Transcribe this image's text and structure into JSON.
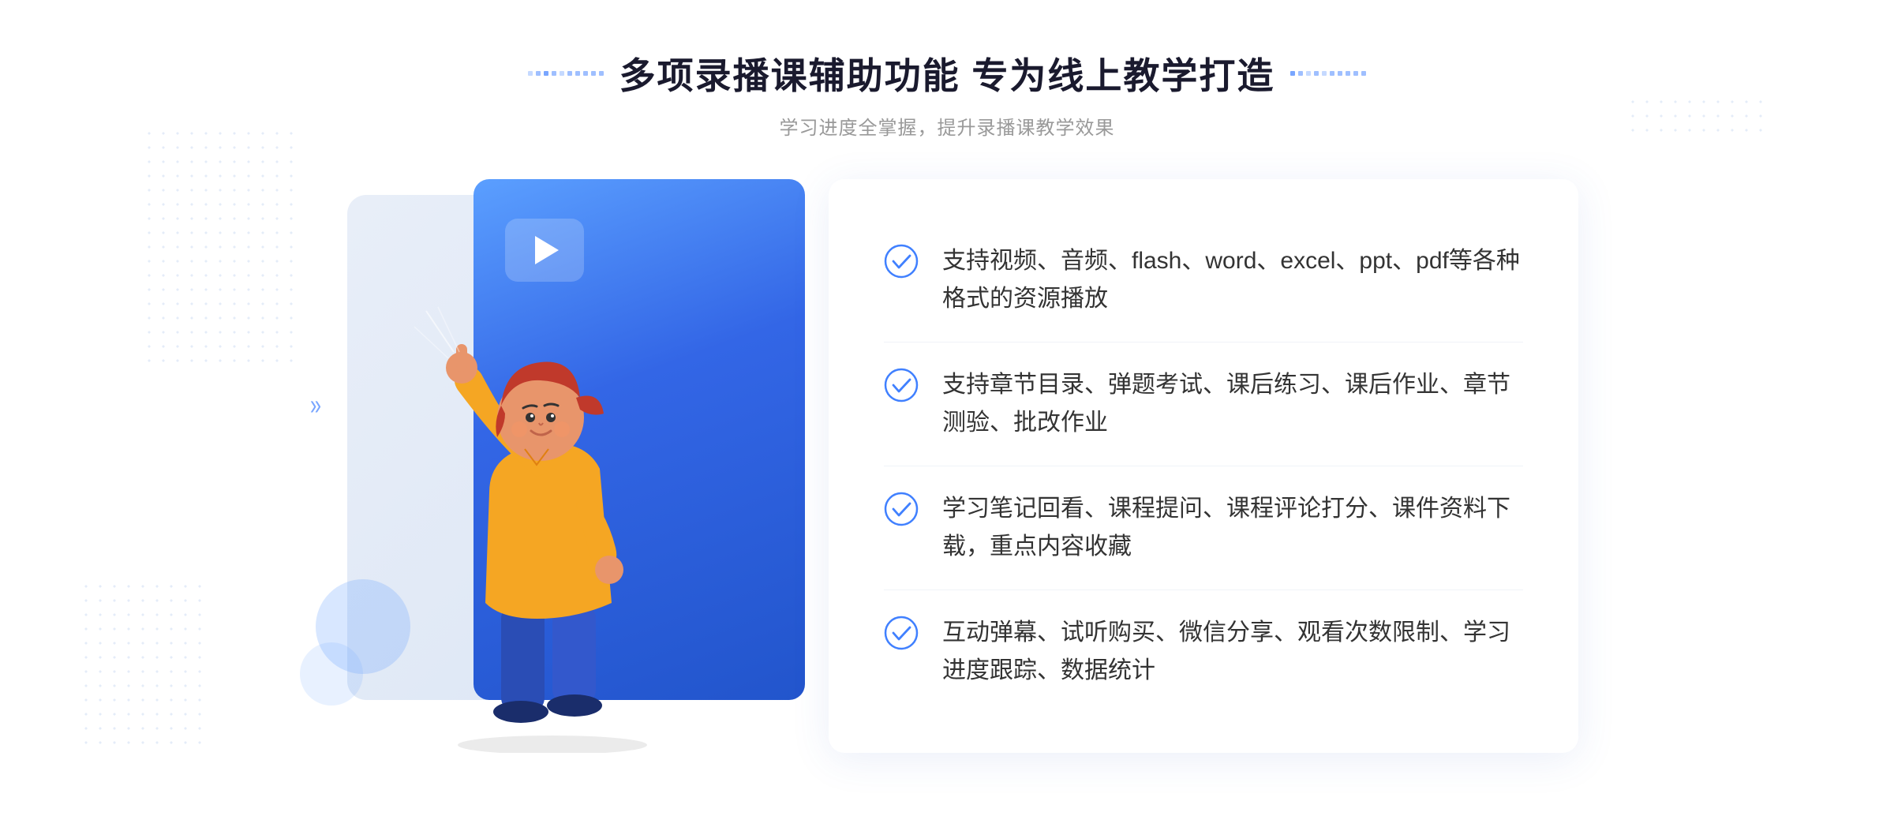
{
  "header": {
    "main_title": "多项录播课辅助功能 专为线上教学打造",
    "sub_title": "学习进度全掌握，提升录播课教学效果"
  },
  "features": [
    {
      "id": 1,
      "text": "支持视频、音频、flash、word、excel、ppt、pdf等各种格式的资源播放"
    },
    {
      "id": 2,
      "text": "支持章节目录、弹题考试、课后练习、课后作业、章节测验、批改作业"
    },
    {
      "id": 3,
      "text": "学习笔记回看、课程提问、课程评论打分、课件资料下载，重点内容收藏"
    },
    {
      "id": 4,
      "text": "互动弹幕、试听购买、微信分享、观看次数限制、学习进度跟踪、数据统计"
    }
  ],
  "decoration": {
    "chevron": "»",
    "star": "✦"
  },
  "colors": {
    "blue_accent": "#3d6fe8",
    "light_blue": "#5b9fff",
    "title_color": "#1a1a2e",
    "text_color": "#333333",
    "sub_color": "#999999"
  }
}
